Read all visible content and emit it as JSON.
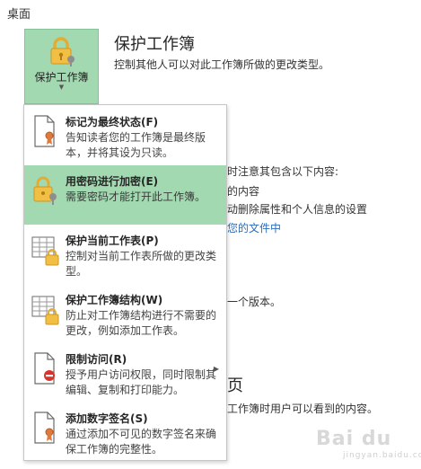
{
  "page": {
    "breadcrumb": "桌面"
  },
  "protect_button": {
    "label": "保护工作簿",
    "dropdown_glyph": "▼",
    "icon": "lock-key-icon"
  },
  "section": {
    "title": "保护工作簿",
    "description": "控制其他人可以对此工作簿所做的更改类型。"
  },
  "background": {
    "inspect_line": "时注意其包含以下内容:",
    "inspect_sub1": "的内容",
    "inspect_sub2": "动删除属性和个人信息的设置",
    "inspect_link": "您的文件中",
    "versions_line": "一个版本。",
    "browser_heading": "页",
    "browser_line": "工作簿时用户可以看到的内容。"
  },
  "menu": {
    "items": [
      {
        "title": "标记为最终状态(F)",
        "desc": "告知读者您的工作簿是最终版本，并将其设为只读。",
        "icon": "document-ribbon-icon",
        "highlighted": false
      },
      {
        "title": "用密码进行加密(E)",
        "desc": "需要密码才能打开此工作簿。",
        "icon": "lock-key-icon",
        "highlighted": true
      },
      {
        "title": "保护当前工作表(P)",
        "desc": "控制对当前工作表所做的更改类型。",
        "icon": "sheet-lock-icon",
        "highlighted": false
      },
      {
        "title": "保护工作簿结构(W)",
        "desc": "防止对工作簿结构进行不需要的更改，例如添加工作表。",
        "icon": "sheet-lock-icon",
        "highlighted": false
      },
      {
        "title": "限制访问(R)",
        "desc": "授予用户访问权限，同时限制其编辑、复制和打印能力。",
        "icon": "document-restrict-icon",
        "highlighted": false,
        "submenu_glyph": "▶"
      },
      {
        "title": "添加数字签名(S)",
        "desc": "通过添加不可见的数字签名来确保工作簿的完整性。",
        "icon": "document-ribbon-icon",
        "highlighted": false
      }
    ]
  },
  "watermark": {
    "text": "Bai du",
    "sub": "jingyan.baidu.com"
  }
}
